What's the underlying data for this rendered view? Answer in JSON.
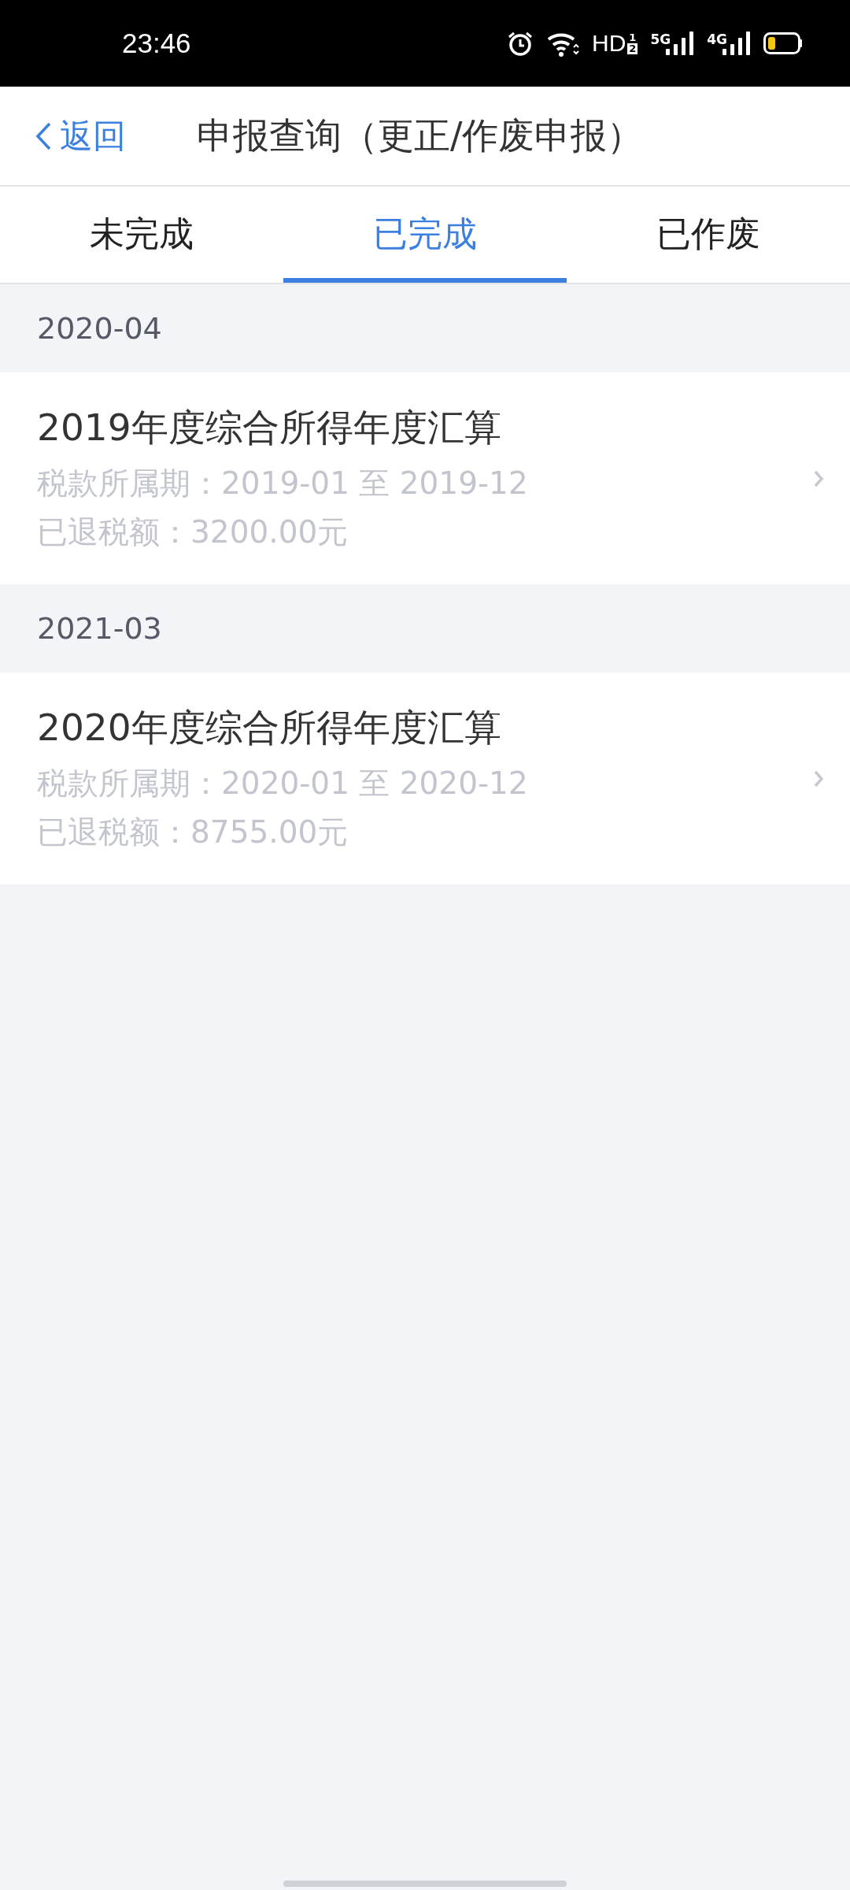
{
  "status_bar": {
    "time": "23:46",
    "hd": "HD",
    "hd_sims": [
      "1",
      "2"
    ],
    "networks": [
      "5G",
      "4G"
    ]
  },
  "header": {
    "back": "返回",
    "title": "申报查询（更正/作废申报）"
  },
  "tabs": [
    {
      "label": "未完成",
      "selected": false
    },
    {
      "label": "已完成",
      "selected": true
    },
    {
      "label": "已作废",
      "selected": false
    }
  ],
  "sections": [
    {
      "date": "2020-04",
      "items": [
        {
          "title": "2019年度综合所得年度汇算",
          "period": "税款所属期：2019-01 至 2019-12",
          "refund": "已退税额：3200.00元"
        }
      ]
    },
    {
      "date": "2021-03",
      "items": [
        {
          "title": "2020年度综合所得年度汇算",
          "period": "税款所属期：2020-01 至 2020-12",
          "refund": "已退税额：8755.00元"
        }
      ]
    }
  ]
}
